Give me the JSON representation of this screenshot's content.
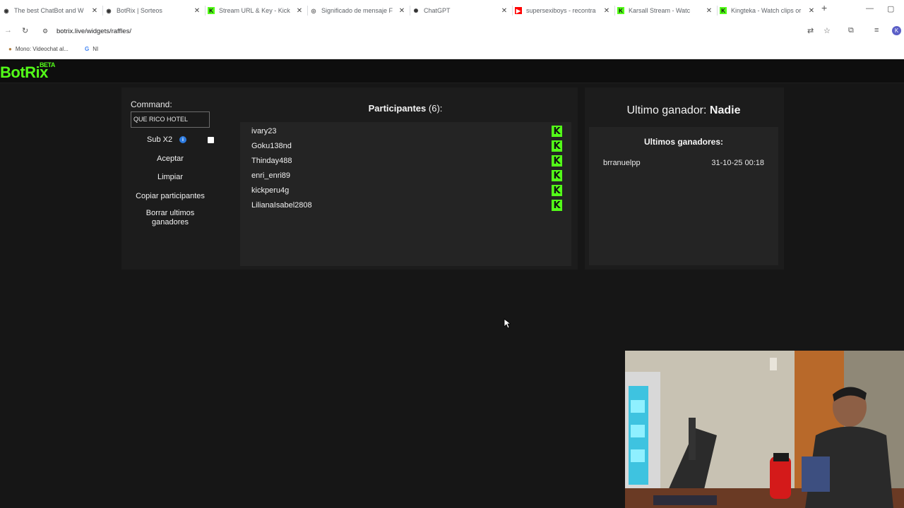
{
  "browser": {
    "tabs": [
      {
        "title": "The best ChatBot and W",
        "icon": "botrix-icon",
        "active": false
      },
      {
        "title": "BotRix | Sorteos",
        "icon": "botrix-icon",
        "active": true
      },
      {
        "title": "Stream URL & Key - Kick",
        "icon": "kick-icon",
        "active": false
      },
      {
        "title": "Significado de mensaje F",
        "icon": "globe-icon",
        "active": false
      },
      {
        "title": "ChatGPT",
        "icon": "chatgpt-icon",
        "active": false
      },
      {
        "title": "supersexiboys - recontra",
        "icon": "youtube-icon",
        "active": false
      },
      {
        "title": "Karsall Stream - Watc",
        "icon": "kick-icon",
        "active": false
      },
      {
        "title": "Kingteka - Watch clips or",
        "icon": "kick-icon",
        "active": false
      }
    ],
    "url": "botrix.live/widgets/raffles/",
    "bookmarks": [
      {
        "label": "Mono: Videochat al...",
        "icon": "mono-icon"
      },
      {
        "label": "NI",
        "icon": "google-icon"
      }
    ],
    "profile_initial": "K"
  },
  "app": {
    "logo": "BotRix",
    "logo_badge": "BETA",
    "accent_color": "#53fc18"
  },
  "controls": {
    "command_label": "Command:",
    "command_value": "QUE RICO HOTEL",
    "sub_label": "Sub X2",
    "sub_checked": false,
    "buttons": {
      "accept": "Aceptar",
      "clear": "Limpiar",
      "copy": "Copiar participantes",
      "delete_winners": "Borrar ultimos ganadores"
    }
  },
  "participants": {
    "title": "Participantes",
    "count": "(6):",
    "list": [
      "ivary23",
      "Goku138nd",
      "Thinday488",
      "enri_enri89",
      "kickperu4g",
      "LilianaIsabel2808"
    ]
  },
  "winners": {
    "last_label": "Ultimo ganador:",
    "last_name": "Nadie",
    "recent_title": "Ultimos ganadores:",
    "recent": [
      {
        "name": "brranuelpp",
        "date": "31-10-25 00:18"
      }
    ]
  }
}
